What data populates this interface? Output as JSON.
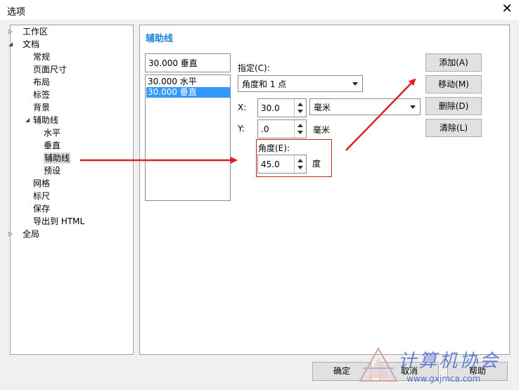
{
  "window": {
    "title": "选项",
    "close_glyph": "✕"
  },
  "tree": [
    {
      "label": "工作区",
      "level": 0,
      "marker": "▷"
    },
    {
      "label": "文档",
      "level": 0,
      "marker": "◢"
    },
    {
      "label": "常规",
      "level": 1
    },
    {
      "label": "页面尺寸",
      "level": 1
    },
    {
      "label": "布局",
      "level": 1
    },
    {
      "label": "标签",
      "level": 1
    },
    {
      "label": "背景",
      "level": 1
    },
    {
      "label": "辅助线",
      "level": 1,
      "marker": "◢"
    },
    {
      "label": "水平",
      "level": 2
    },
    {
      "label": "垂直",
      "level": 2
    },
    {
      "label": "辅助线",
      "level": 2,
      "selected": true
    },
    {
      "label": "预设",
      "level": 2
    },
    {
      "label": "网格",
      "level": 1
    },
    {
      "label": "标尺",
      "level": 1
    },
    {
      "label": "保存",
      "level": 1
    },
    {
      "label": "导出到 HTML",
      "level": 1
    },
    {
      "label": "全局",
      "level": 0,
      "marker": "▷"
    }
  ],
  "panel": {
    "heading": "辅助线",
    "entry_value": "30.000 垂直",
    "list": [
      {
        "label": "30.000 水平",
        "selected": false
      },
      {
        "label": "30.000 垂直",
        "selected": true
      }
    ],
    "specify_label": "指定(C):",
    "specify_value": "角度和 1 点",
    "x_label": "X:",
    "x_value": "30.0",
    "y_label": "Y:",
    "y_value": ".0",
    "unit_value": "毫米",
    "y_unit": "毫米",
    "angle_label": "角度(E):",
    "angle_value": "45.0",
    "angle_unit": "度"
  },
  "side_buttons": {
    "add": "添加(A)",
    "move": "移动(M)",
    "delete": "删除(D)",
    "clear": "清除(L)"
  },
  "footer_buttons": {
    "ok": "确定",
    "cancel": "取消",
    "help": "帮助"
  },
  "watermark": {
    "text": "计算机协会",
    "url": "www.gxjmca.com"
  },
  "colors": {
    "accent": "#1a83d8",
    "selection": "#3399ff",
    "annotation": "#e02020"
  }
}
